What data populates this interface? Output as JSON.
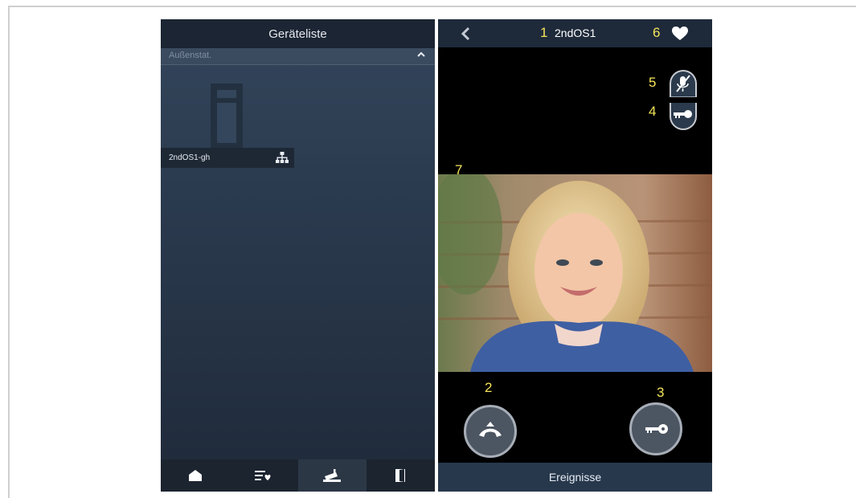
{
  "left_screen": {
    "header_title": "Geräteliste",
    "section_label": "Außenstat.",
    "device_label": "2ndOS1-gh",
    "tabs": [
      {
        "icon": "home-icon"
      },
      {
        "icon": "favorites-list-icon"
      },
      {
        "icon": "camera-icon",
        "active": true
      },
      {
        "icon": "door-icon"
      }
    ]
  },
  "right_screen": {
    "header_title": "2ndOS1",
    "footer_label": "Ereignisse",
    "callouts": {
      "one": "1",
      "two": "2",
      "three": "3",
      "four": "4",
      "five": "5",
      "six": "6",
      "seven": "7"
    }
  },
  "colors": {
    "callout": "#f4e35a",
    "header_dark": "#1b2533",
    "button_border": "#a7aeb8"
  }
}
